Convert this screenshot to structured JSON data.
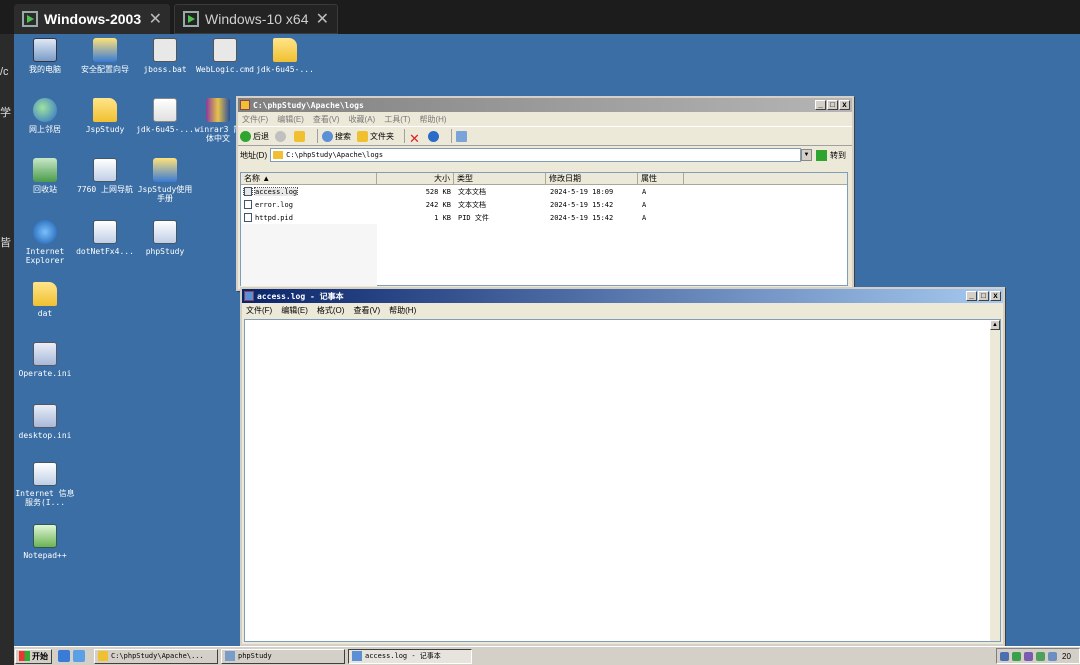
{
  "host": {
    "tabs": [
      {
        "label": "Windows-2003",
        "active": true
      },
      {
        "label": "Windows-10 x64",
        "active": false
      }
    ],
    "left_fragments": [
      "/c",
      "学",
      "皆"
    ]
  },
  "desktop": {
    "background": "#3a6ea5",
    "icons": [
      {
        "label": "我的电脑",
        "icon": "computer-icon"
      },
      {
        "label": "安全配置向导",
        "icon": "wizard-icon"
      },
      {
        "label": "jboss.bat",
        "icon": "batch-file-icon"
      },
      {
        "label": "WebLogic.cmd",
        "icon": "batch-file-icon"
      },
      {
        "label": "jdk-6u45-...",
        "icon": "folder-icon"
      },
      {
        "label": "网上邻居",
        "icon": "network-icon"
      },
      {
        "label": "JspStudy",
        "icon": "folder-icon"
      },
      {
        "label": "jdk-6u45-...",
        "icon": "java-icon"
      },
      {
        "label": "winrar3 简体中文",
        "icon": "winrar-icon"
      },
      {
        "label": "回收站",
        "icon": "recycle-bin-icon"
      },
      {
        "label": "7760 上网导航",
        "icon": "program-icon"
      },
      {
        "label": "JspStudy使用手册",
        "icon": "wizard-icon"
      },
      {
        "label": "Internet Explorer",
        "icon": "ie-icon"
      },
      {
        "label": "dotNetFx4...",
        "icon": "program-icon"
      },
      {
        "label": "phpStudy",
        "icon": "program-icon"
      },
      {
        "label": "dat",
        "icon": "folder-icon"
      },
      {
        "label": "Operate.ini",
        "icon": "ini-file-icon"
      },
      {
        "label": "desktop.ini",
        "icon": "ini-file-icon"
      },
      {
        "label": "Internet 信息服务(I...",
        "icon": "program-icon"
      },
      {
        "label": "Notepad++",
        "icon": "notepadpp-icon"
      }
    ]
  },
  "explorer": {
    "title": "C:\\phpStudy\\Apache\\logs",
    "menu": [
      "文件(F)",
      "编辑(E)",
      "查看(V)",
      "收藏(A)",
      "工具(T)",
      "帮助(H)"
    ],
    "toolbar": {
      "back": "后退",
      "search": "搜索",
      "folders": "文件夹"
    },
    "address_label": "地址(D)",
    "address_value": "C:\\phpStudy\\Apache\\logs",
    "go_label": "转到",
    "columns": {
      "name": "名称 ▲",
      "size": "大小",
      "type": "类型",
      "modified": "修改日期",
      "attributes": "属性"
    },
    "files": [
      {
        "name": "access.log",
        "size": "528 KB",
        "type": "文本文档",
        "modified": "2024-5-19 18:09",
        "attr": "A"
      },
      {
        "name": "error.log",
        "size": "242 KB",
        "type": "文本文档",
        "modified": "2024-5-19 15:42",
        "attr": "A"
      },
      {
        "name": "httpd.pid",
        "size": "1 KB",
        "type": "PID 文件",
        "modified": "2024-5-19 15:42",
        "attr": "A"
      }
    ]
  },
  "notepad": {
    "title": "access.log - 记事本",
    "menu": [
      "文件(F)",
      "编辑(E)",
      "格式(O)",
      "查看(V)",
      "帮助(H)"
    ],
    "content": ""
  },
  "window_buttons": {
    "minimize": "_",
    "maximize": "□",
    "close": "x"
  },
  "taskbar": {
    "start": "开始",
    "items": [
      {
        "label": "C:\\phpStudy\\Apache\\...",
        "pressed": false
      },
      {
        "label": "phpStudy",
        "pressed": false
      },
      {
        "label": "access.log - 记事本",
        "pressed": true
      }
    ],
    "clock": "20"
  }
}
